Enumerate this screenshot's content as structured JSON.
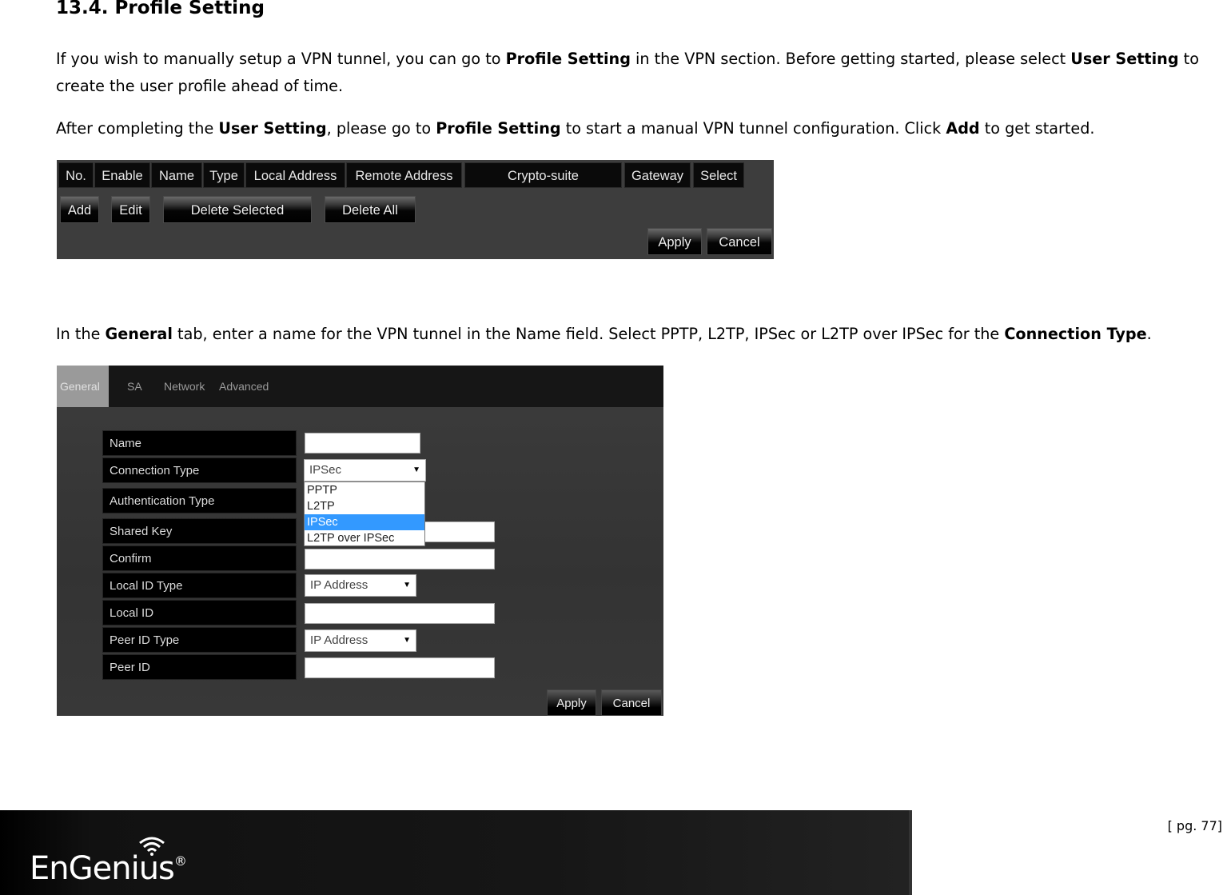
{
  "heading": "13.4.  Profile Setting",
  "paragraphs": {
    "p1": [
      {
        "t": "If you wish to manually setup a VPN tunnel, you can go to ",
        "b": false
      },
      {
        "t": "Profile Setting",
        "b": true
      },
      {
        "t": " in the VPN section. Before getting started, please select ",
        "b": false
      },
      {
        "t": "User Setting",
        "b": true
      },
      {
        "t": " to create the user profile ahead of time.",
        "b": false
      }
    ],
    "p2": [
      {
        "t": "After completing the ",
        "b": false
      },
      {
        "t": "User Setting",
        "b": true
      },
      {
        "t": ", please go to ",
        "b": false
      },
      {
        "t": "Profile Setting",
        "b": true
      },
      {
        "t": " to start a manual VPN tunnel configuration. Click ",
        "b": false
      },
      {
        "t": "Add",
        "b": true
      },
      {
        "t": " to get started.",
        "b": false
      }
    ],
    "p3": [
      {
        "t": "In the ",
        "b": false
      },
      {
        "t": "General",
        "b": true
      },
      {
        "t": " tab, enter a name for the VPN tunnel in the Name field. Select PPTP, L2TP, IPSec or L2TP over IPSec for the ",
        "b": false
      },
      {
        "t": "Connection Type",
        "b": true
      },
      {
        "t": ".",
        "b": false
      }
    ]
  },
  "profile_table": {
    "columns": [
      "No.",
      "Enable",
      "Name",
      "Type",
      "Local Address",
      "Remote Address",
      "Crypto-suite",
      "Gateway",
      "Select"
    ],
    "buttons": {
      "add": "Add",
      "edit": "Edit",
      "delete_selected": "Delete Selected",
      "delete_all": "Delete All",
      "apply": "Apply",
      "cancel": "Cancel"
    }
  },
  "general_form": {
    "tabs": [
      "General",
      "SA",
      "Network",
      "Advanced"
    ],
    "active_tab": "General",
    "fields": {
      "name": {
        "label": "Name",
        "value": ""
      },
      "connection_type": {
        "label": "Connection Type",
        "value": "IPSec"
      },
      "authentication_type": {
        "label": "Authentication Type"
      },
      "shared_key": {
        "label": "Shared Key",
        "value": ""
      },
      "confirm": {
        "label": "Confirm",
        "value": ""
      },
      "local_id_type": {
        "label": "Local ID Type",
        "value": "IP Address"
      },
      "local_id": {
        "label": "Local ID",
        "value": ""
      },
      "peer_id_type": {
        "label": "Peer ID Type",
        "value": "IP Address"
      },
      "peer_id": {
        "label": "Peer ID",
        "value": ""
      }
    },
    "connection_type_options": [
      "PPTP",
      "L2TP",
      "IPSec",
      "L2TP over IPSec"
    ],
    "highlighted_option": "IPSec",
    "buttons": {
      "apply": "Apply",
      "cancel": "Cancel"
    }
  },
  "footer": {
    "logo": "EnGenius",
    "registered_mark": "®",
    "page_number": "[ pg. 77]"
  },
  "colors": {
    "highlight": "#3399ff",
    "panel_bg": "#3d3d3d"
  }
}
